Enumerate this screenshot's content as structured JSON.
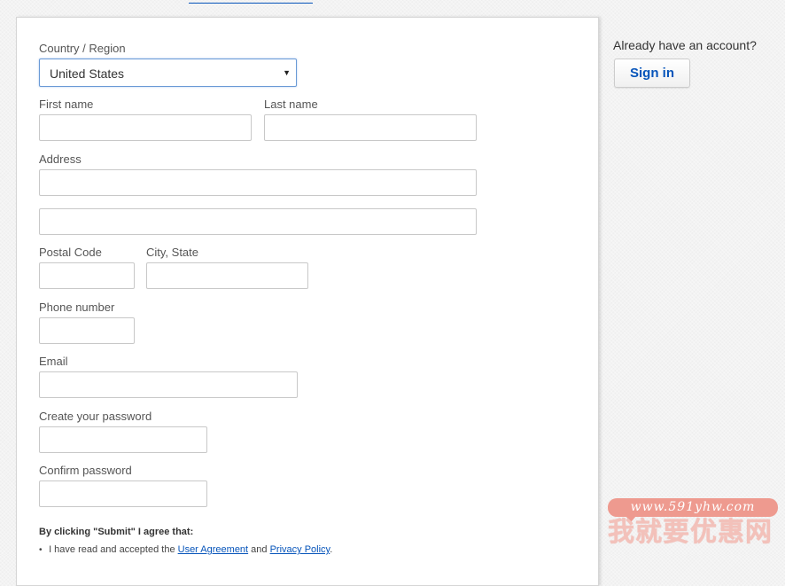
{
  "form": {
    "country": {
      "label": "Country / Region",
      "value": "United States"
    },
    "first_name": {
      "label": "First name",
      "value": ""
    },
    "last_name": {
      "label": "Last name",
      "value": ""
    },
    "address": {
      "label": "Address",
      "line1": "",
      "line2": ""
    },
    "postal_code": {
      "label": "Postal Code",
      "value": ""
    },
    "city_state": {
      "label": "City, State",
      "value": ""
    },
    "phone": {
      "label": "Phone number",
      "value": ""
    },
    "email": {
      "label": "Email",
      "value": ""
    },
    "password": {
      "label": "Create your password",
      "value": ""
    },
    "confirm_password": {
      "label": "Confirm password",
      "value": ""
    }
  },
  "agreement": {
    "title": "By clicking \"Submit\" I agree that:",
    "item_prefix": "I have read and accepted the",
    "user_agreement_link": "User Agreement",
    "conjunction": "and",
    "privacy_policy_link": "Privacy Policy",
    "suffix": "."
  },
  "sidebar": {
    "prompt": "Already have an account?",
    "sign_in_label": "Sign in"
  },
  "watermark": {
    "url": "www.591yhw.com",
    "text": "我就要优惠网"
  },
  "colors": {
    "link": "#0654ba",
    "focus_border": "#6a9ad6",
    "watermark_pink": "#ee9a8f"
  }
}
